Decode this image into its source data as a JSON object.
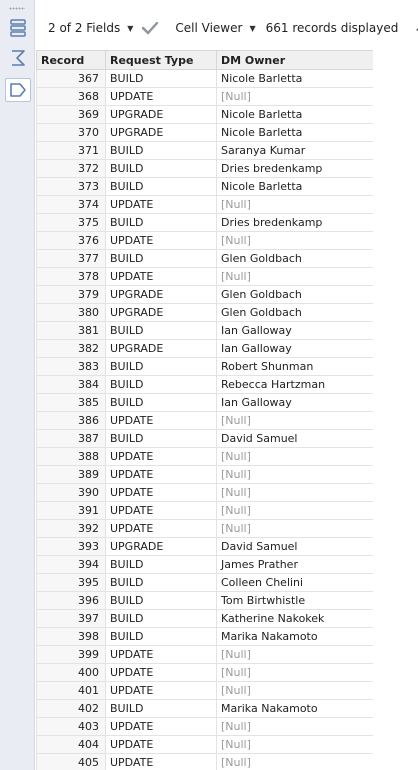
{
  "toolbar": {
    "fields_label": "2 of 2 Fields",
    "viewer_label": "Cell Viewer",
    "records_label": "661 records displayed"
  },
  "table": {
    "columns": [
      "Record",
      "Request Type",
      "DM Owner"
    ],
    "rows": [
      [
        "367",
        "BUILD",
        "Nicole Barletta"
      ],
      [
        "368",
        "UPDATE",
        "[Null]"
      ],
      [
        "369",
        "UPGRADE",
        "Nicole Barletta"
      ],
      [
        "370",
        "UPGRADE",
        "Nicole Barletta"
      ],
      [
        "371",
        "BUILD",
        "Saranya Kumar"
      ],
      [
        "372",
        "BUILD",
        "Dries bredenkamp"
      ],
      [
        "373",
        "BUILD",
        "Nicole Barletta"
      ],
      [
        "374",
        "UPDATE",
        "[Null]"
      ],
      [
        "375",
        "BUILD",
        "Dries bredenkamp"
      ],
      [
        "376",
        "UPDATE",
        "[Null]"
      ],
      [
        "377",
        "BUILD",
        "Glen Goldbach"
      ],
      [
        "378",
        "UPDATE",
        "[Null]"
      ],
      [
        "379",
        "UPGRADE",
        "Glen Goldbach"
      ],
      [
        "380",
        "UPGRADE",
        "Glen Goldbach"
      ],
      [
        "381",
        "BUILD",
        "Ian Galloway"
      ],
      [
        "382",
        "UPGRADE",
        "Ian Galloway"
      ],
      [
        "383",
        "BUILD",
        "Robert Shunman"
      ],
      [
        "384",
        "BUILD",
        "Rebecca Hartzman"
      ],
      [
        "385",
        "BUILD",
        "Ian Galloway"
      ],
      [
        "386",
        "UPDATE",
        "[Null]"
      ],
      [
        "387",
        "BUILD",
        "David Samuel"
      ],
      [
        "388",
        "UPDATE",
        "[Null]"
      ],
      [
        "389",
        "UPDATE",
        "[Null]"
      ],
      [
        "390",
        "UPDATE",
        "[Null]"
      ],
      [
        "391",
        "UPDATE",
        "[Null]"
      ],
      [
        "392",
        "UPDATE",
        "[Null]"
      ],
      [
        "393",
        "UPGRADE",
        "David Samuel"
      ],
      [
        "394",
        "BUILD",
        "James Prather"
      ],
      [
        "395",
        "BUILD",
        "Colleen Chelini"
      ],
      [
        "396",
        "BUILD",
        "Tom Birtwhistle"
      ],
      [
        "397",
        "BUILD",
        "Katherine Nakokek"
      ],
      [
        "398",
        "BUILD",
        "Marika Nakamoto"
      ],
      [
        "399",
        "UPDATE",
        "[Null]"
      ],
      [
        "400",
        "UPDATE",
        "[Null]"
      ],
      [
        "401",
        "UPDATE",
        "[Null]"
      ],
      [
        "402",
        "BUILD",
        "Marika Nakamoto"
      ],
      [
        "403",
        "UPDATE",
        "[Null]"
      ],
      [
        "404",
        "UPDATE",
        "[Null]"
      ],
      [
        "405",
        "UPDATE",
        "[Null]"
      ]
    ]
  },
  "icons": {
    "strip": [
      "table-view-icon",
      "sigma-summary-icon",
      "tag-label-icon"
    ],
    "toolbar": [
      "checkmark-icon",
      "pin-icon"
    ]
  },
  "colors": {
    "strip_bg": "#e9edf3",
    "header_bg": "#f0f0f0",
    "null_text": "#9a9a9a"
  }
}
